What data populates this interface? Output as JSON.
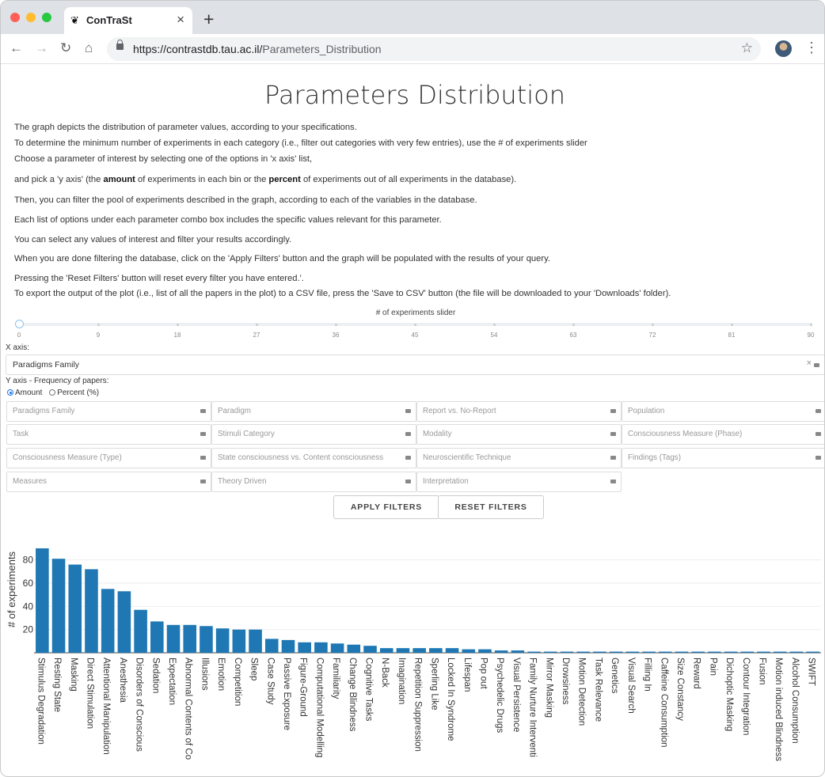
{
  "browser": {
    "tab_title": "ConTraSt",
    "tab_close": "×",
    "new_tab": "+",
    "url_host": "https://contrastdb.tau.ac.il/",
    "url_path": "Parameters_Distribution",
    "nav": {
      "back": "←",
      "forward": "→",
      "reload": "↻",
      "home": "⌂",
      "star": "☆",
      "menu": "⋮"
    },
    "traffic_colors": [
      "#ff5f57",
      "#febc2e",
      "#28c840"
    ]
  },
  "page": {
    "title": "Parameters Distribution",
    "paragraphs": [
      "The graph depicts the distribution of parameter values, according to your specifications.",
      "To determine the minimum number of experiments in each category (i.e., filter out categories with very few entries), use the # of experiments slider",
      "Choose a parameter of interest by selecting one of the options in 'x axis' list,",
      "and pick a 'y axis' (the @@amount@@ of experiments in each bin or the @@percent@@ of experiments  out of all experiments in the database).",
      "Then, you can filter the pool of experiments described in the graph, according to each of the variables in the database.",
      "Each list of options under each parameter combo box includes the specific values relevant for this parameter.",
      "You can select any values of interest and filter your results accordingly.",
      "When you are done filtering the database, click on the 'Apply Filters' button and the graph will be populated with the results of your query.",
      "Pressing the 'Reset Filters' button will reset every filter you have entered.'.",
      "To export the output of the plot (i.e., list of all the papers in the plot) to a CSV file, press the 'Save to CSV' button (the file will be downloaded to your 'Downloads' folder)."
    ]
  },
  "slider": {
    "label": "# of experiments slider",
    "value": 0,
    "ticks": [
      "0",
      "9",
      "18",
      "27",
      "36",
      "45",
      "54",
      "63",
      "72",
      "81",
      "90"
    ]
  },
  "x_axis": {
    "caption": "X axis:",
    "value": "Paradigms Family",
    "clear": "×"
  },
  "y_axis": {
    "caption": "Y axis - Frequency of papers:",
    "options": [
      "Amount",
      "Percent (%)"
    ],
    "selected": "Amount"
  },
  "filters": [
    "Paradigms Family",
    "Paradigm",
    "Report vs. No-Report",
    "Population",
    "Task",
    "Stimuli Category",
    "Modality",
    "Consciousness Measure (Phase)",
    "Consciousness Measure (Type)",
    "State consciousness vs. Content consciousness",
    "Neuroscientific Technique",
    "Findings (Tags)",
    "Measures",
    "Theory Driven",
    "Interpretation"
  ],
  "buttons": {
    "apply": "APPLY FILTERS",
    "reset": "RESET FILTERS"
  },
  "chart_data": {
    "type": "bar",
    "ylabel": "# of experiments",
    "xlabel": "",
    "yticks": [
      20,
      40,
      60,
      80
    ],
    "ylim": [
      0,
      90
    ],
    "grid": true,
    "bar_color": "#1f77b4",
    "categories": [
      "Stimulus Degradation",
      "Resting State",
      "Masking",
      "Direct Stimulation",
      "Attentional Manipulation",
      "Anesthesia",
      "Disorders of Conscious",
      "Sedation",
      "Expectation",
      "Abnormal Contents of Co",
      "Illusions",
      "Emotion",
      "Competition",
      "Sleep",
      "Case Study",
      "Passive Exposure",
      "Figure-Ground",
      "Computational Modelling",
      "Familiarity",
      "Change Blindness",
      "Cognitive Tasks",
      "N-Back",
      "Imagination",
      "Repetition Suppression",
      "Sperling Like",
      "Locked In Syndrome",
      "Lifespan",
      "Pop out",
      "Psychedelic Drugs",
      "Visual Persistence",
      "Family Nurture Interventi",
      "Mirror Masking",
      "Drowsiness",
      "Motion Detection",
      "Task Relevance",
      "Genetics",
      "Visual Search",
      "Filling In",
      "Caffeine Consumption",
      "Size Constancy",
      "Reward",
      "Pain",
      "Dichoptic Masking",
      "Contour Integration",
      "Fusion",
      "Motion induced Blindness",
      "Alcohol Consumption",
      "SWIFT"
    ],
    "values": [
      90,
      81,
      76,
      72,
      55,
      53,
      37,
      27,
      24,
      24,
      23,
      21,
      20,
      20,
      12,
      11,
      9,
      9,
      8,
      7,
      6,
      4,
      4,
      4,
      4,
      4,
      3,
      3,
      2,
      2,
      1,
      1,
      1,
      1,
      1,
      1,
      1,
      1,
      1,
      1,
      1,
      1,
      1,
      1,
      1,
      1,
      1,
      1
    ]
  }
}
